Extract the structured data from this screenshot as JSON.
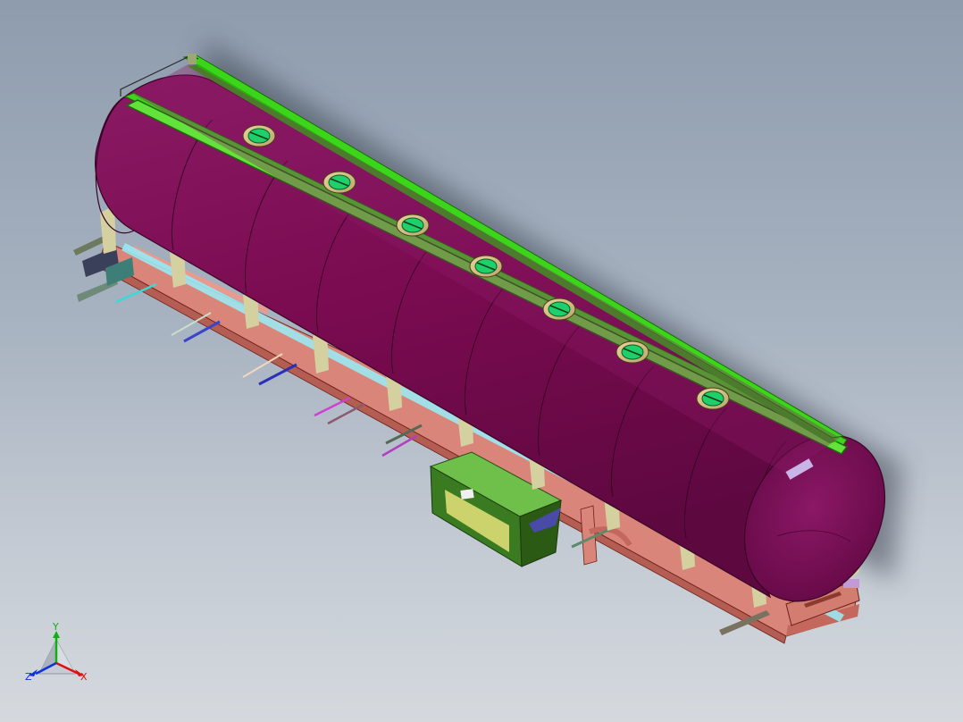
{
  "viewport": {
    "background_top": "#8e9cad",
    "background_bottom": "#d5d9de"
  },
  "model": {
    "tank_color": "#7d0b52",
    "rail_color": "#3bd61a",
    "frame_color": "#d9857a",
    "hatch_count": 7,
    "tank_segments": 9
  },
  "triad": {
    "x_label": "X",
    "y_label": "Y",
    "z_label": "Z",
    "x_color": "#e01010",
    "y_color": "#10b010",
    "z_color": "#1030e0"
  }
}
